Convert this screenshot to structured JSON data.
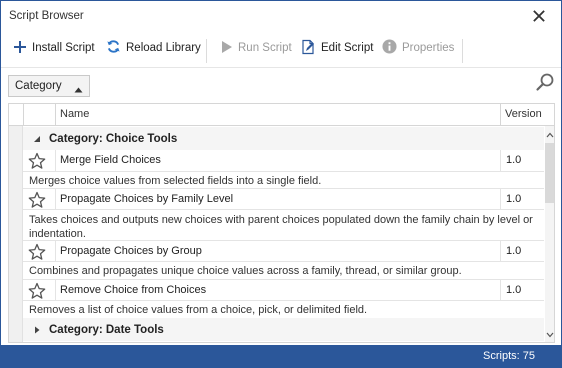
{
  "window": {
    "title": "Script Browser",
    "close_icon": "close-icon"
  },
  "toolbar": {
    "install_label": "Install Script",
    "reload_label": "Reload Library",
    "run_label": "Run Script",
    "edit_label": "Edit Script",
    "properties_label": "Properties"
  },
  "filter": {
    "category_label": "Category"
  },
  "grid": {
    "columns": {
      "name": "Name",
      "version": "Version"
    },
    "groups": [
      {
        "label": "Category: Choice Tools",
        "expanded": true,
        "rows": [
          {
            "name": "Merge Field Choices",
            "version": "1.0",
            "description": "Merges choice values from selected fields into a single field."
          },
          {
            "name": "Propagate Choices by Family Level",
            "version": "1.0",
            "description": "Takes choices and outputs new choices with parent choices populated down the family chain by level or indentation."
          },
          {
            "name": "Propagate Choices by Group",
            "version": "1.0",
            "description": "Combines and propagates unique choice values across a family, thread, or similar group."
          },
          {
            "name": "Remove Choice from Choices",
            "version": "1.0",
            "description": "Removes a list of choice values from a choice, pick, or delimited field."
          }
        ]
      },
      {
        "label": "Category: Date Tools",
        "expanded": false
      }
    ]
  },
  "status": {
    "scripts_count": "Scripts: 75"
  },
  "colors": {
    "accent": "#2b579a",
    "status_bar": "#2b579a"
  }
}
